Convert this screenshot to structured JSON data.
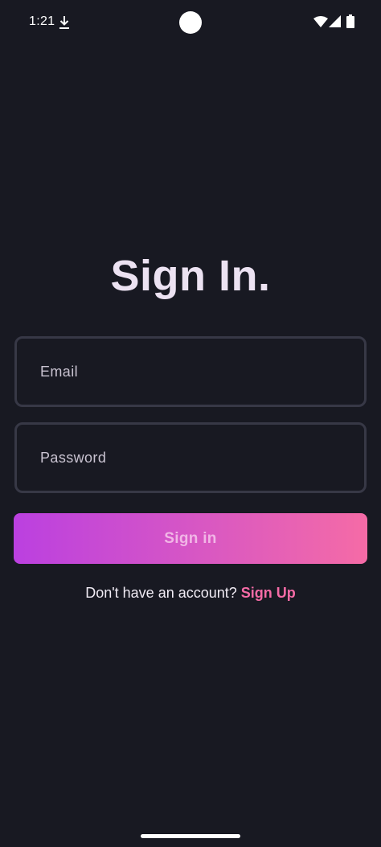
{
  "status_bar": {
    "time": "1:21",
    "icons": [
      "download-icon",
      "wifi-icon",
      "signal-icon",
      "battery-icon"
    ]
  },
  "title": "Sign In.",
  "form": {
    "email": {
      "placeholder": "Email",
      "value": ""
    },
    "password": {
      "placeholder": "Password",
      "value": ""
    },
    "submit_label": "Sign in"
  },
  "footer": {
    "prompt": "Don't have an account?",
    "link_label": "Sign Up"
  },
  "colors": {
    "background": "#181922",
    "field_border": "#373846",
    "gradient_start": "#bb40e0",
    "gradient_end": "#f56ba6",
    "link": "#f56ba6"
  }
}
